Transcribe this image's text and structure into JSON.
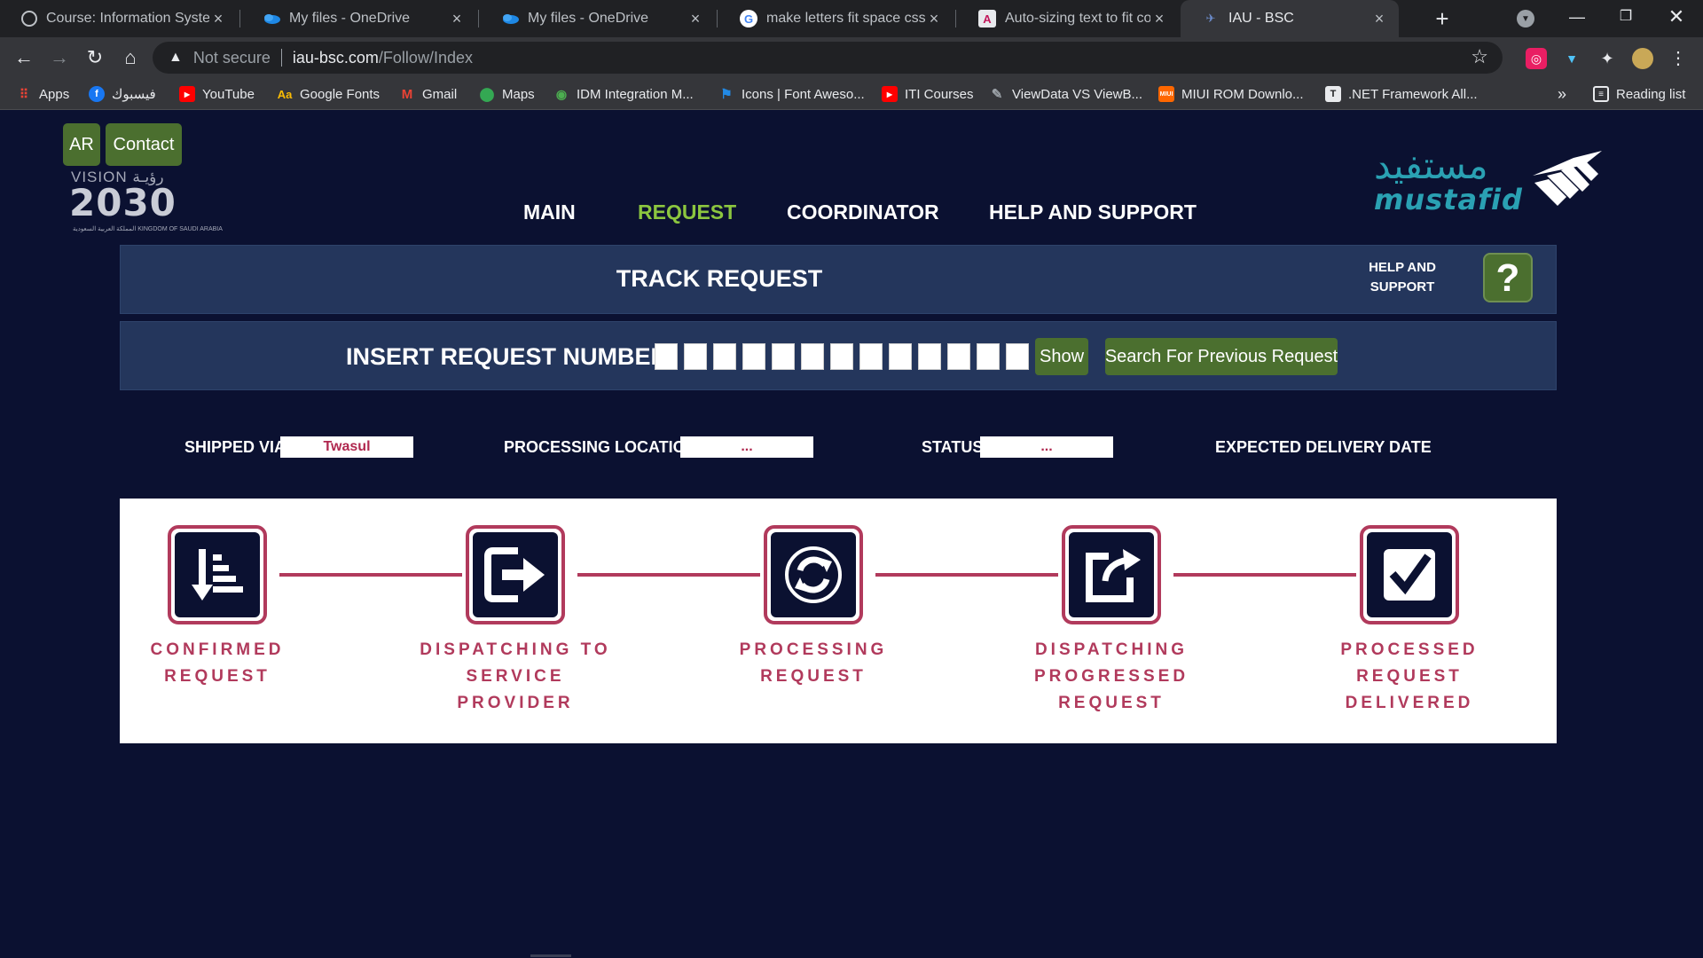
{
  "browser": {
    "tabs": [
      {
        "title": "Course: Information System",
        "icon": "moodle-icon"
      },
      {
        "title": "My files - OneDrive",
        "icon": "onedrive-icon"
      },
      {
        "title": "My files - OneDrive",
        "icon": "onedrive-icon"
      },
      {
        "title": "make letters fit space css - G",
        "icon": "google-icon"
      },
      {
        "title": "Auto-sizing text to fit conta",
        "icon": "codepen-icon"
      },
      {
        "title": "IAU - BSC",
        "icon": "site-icon"
      }
    ],
    "address": {
      "warning": "Not secure",
      "host": "iau-bsc.com",
      "path": "/Follow/Index"
    },
    "bookmarks": [
      {
        "label": "Apps",
        "icon": "apps-grid-icon"
      },
      {
        "label": "فيسبوك",
        "icon": "facebook-icon"
      },
      {
        "label": "YouTube",
        "icon": "youtube-icon"
      },
      {
        "label": "Google Fonts",
        "icon": "google-fonts-icon"
      },
      {
        "label": "Gmail",
        "icon": "gmail-icon"
      },
      {
        "label": "Maps",
        "icon": "maps-icon"
      },
      {
        "label": "IDM Integration M...",
        "icon": "idm-icon"
      },
      {
        "label": "Icons | Font Aweso...",
        "icon": "font-awesome-icon"
      },
      {
        "label": "ITI Courses",
        "icon": "youtube-icon"
      },
      {
        "label": "ViewData VS ViewB...",
        "icon": "stackoverflow-icon"
      },
      {
        "label": "MIUI ROM Downlo...",
        "icon": "miui-icon"
      },
      {
        "label": ".NET Framework All...",
        "icon": "dotnet-icon"
      }
    ],
    "overflow": "»",
    "reading_list": "Reading list"
  },
  "header": {
    "ar_button": "AR",
    "contact_button": "Contact",
    "vision": {
      "title": "VISION رؤيـة",
      "year": "2030",
      "subtitle": "المملكة العربية السعودية KINGDOM OF SAUDI ARABIA"
    },
    "logo": {
      "arabic": "مستفيد",
      "latin": "mustafid"
    }
  },
  "nav": [
    "MAIN",
    "REQUEST",
    "COORDINATOR",
    "HELP AND SUPPORT"
  ],
  "nav_active_index": 1,
  "track": {
    "title": "TRACK REQUEST",
    "help_label": "HELP AND SUPPORT",
    "help_icon": "?"
  },
  "insert": {
    "label": "INSERT REQUEST NUMBER",
    "digit_count": 13,
    "show_button": "Show",
    "search_button": "Search For Previous Request"
  },
  "info": {
    "shipped_via_label": "SHIPPED VIA",
    "shipped_via_value": "Twasul",
    "location_label": "PROCESSING LOCATION",
    "location_value": "...",
    "status_label": "STATUS",
    "status_value": "...",
    "delivery_label": "EXPECTED DELIVERY DATE"
  },
  "steps": [
    {
      "label": "CONFIRMED REQUEST",
      "icon": "sort-down-icon"
    },
    {
      "label": "DISPATCHING TO SERVICE PROVIDER",
      "icon": "sign-out-icon"
    },
    {
      "label": "PROCESSING REQUEST",
      "icon": "refresh-icon"
    },
    {
      "label": "DISPATCHING PROGRESSED REQUEST",
      "icon": "share-box-icon"
    },
    {
      "label": "PROCESSED REQUEST DELIVERED",
      "icon": "checkbox-icon"
    }
  ],
  "colors": {
    "background": "#0b1131",
    "panel": "#24365c",
    "accent_green": "#4b6f2f",
    "nav_active": "#8cc63f",
    "step_accent": "#b13a5c"
  }
}
